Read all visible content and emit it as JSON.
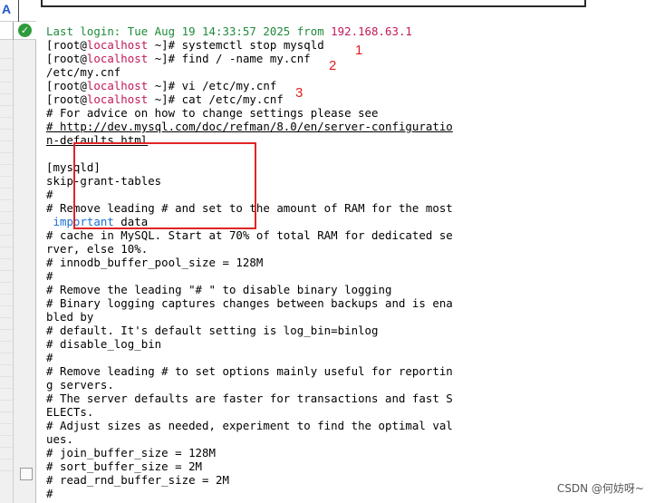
{
  "sidebar": {
    "top_letter": "A",
    "check_symbol": "✓"
  },
  "terminal": {
    "last_login_prefix": "Last login: Tue Aug 19 14:33:57 2025 from ",
    "last_login_ip": "192.168.63.1",
    "prompt_open": "[root@",
    "prompt_host": "localhost",
    "prompt_close": " ~]# ",
    "commands": [
      "systemctl stop mysqld",
      "find / -name my.cnf",
      "vi /etc/my.cnf",
      "cat /etc/my.cnf"
    ],
    "find_result": "/etc/my.cnf",
    "file_lines": [
      "# For advice on how to change settings please see",
      "# http://dev.mysql.com/doc/refman/8.0/en/server-configuratio",
      "n-defaults.html",
      "",
      "[mysqld]",
      "skip-grant-tables",
      "#",
      "# Remove leading # and set to the amount of RAM for the most",
      " important data",
      "# cache in MySQL. Start at 70% of total RAM for dedicated se",
      "rver, else 10%.",
      "# innodb_buffer_pool_size = 128M",
      "#",
      "# Remove the leading \"# \" to disable binary logging",
      "# Binary logging captures changes between backups and is ena",
      "bled by",
      "# default. It's default setting is log_bin=binlog",
      "# disable_log_bin",
      "#",
      "# Remove leading # to set options mainly useful for reportin",
      "g servers.",
      "# The server defaults are faster for transactions and fast S",
      "ELECTs.",
      "# Adjust sizes as needed, experiment to find the optimal val",
      "ues.",
      "# join_buffer_size = 128M",
      "# sort_buffer_size = 2M",
      "# read_rnd_buffer_size = 2M",
      "#"
    ]
  },
  "annotations": [
    "1",
    "2",
    "3"
  ],
  "watermark": "CSDN @何妨呀~",
  "colors": {
    "prompt_host": "#c2185b",
    "annotation_red": "#e02020",
    "highlight_blue": "#1a6fd1"
  }
}
